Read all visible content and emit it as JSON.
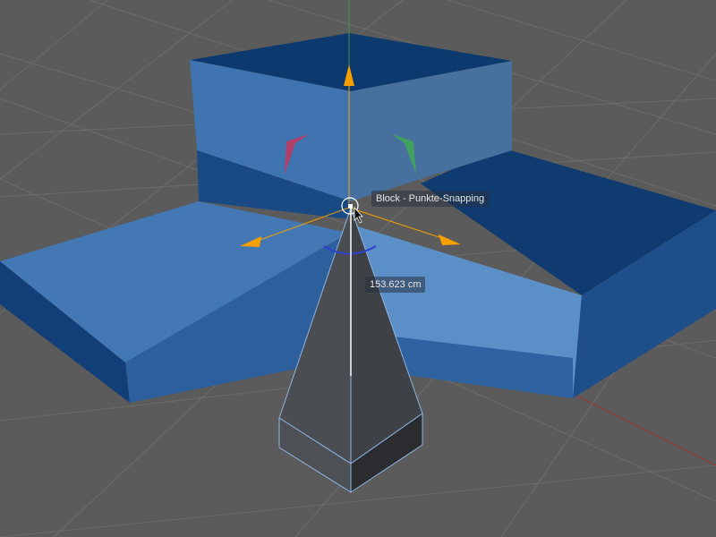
{
  "viewport": {
    "snap_tooltip": "Block - Punkte-Snapping",
    "distance_readout": "153.623 cm"
  },
  "colors": {
    "background": "#5b5b5b",
    "grid": "#6a6a6a",
    "block_top": "#0d3a6e",
    "block_side": "#3e74b0",
    "block_band": "#1e4f8a",
    "axis_handle": "#f5a000",
    "pyramid": "#4a4d52"
  }
}
